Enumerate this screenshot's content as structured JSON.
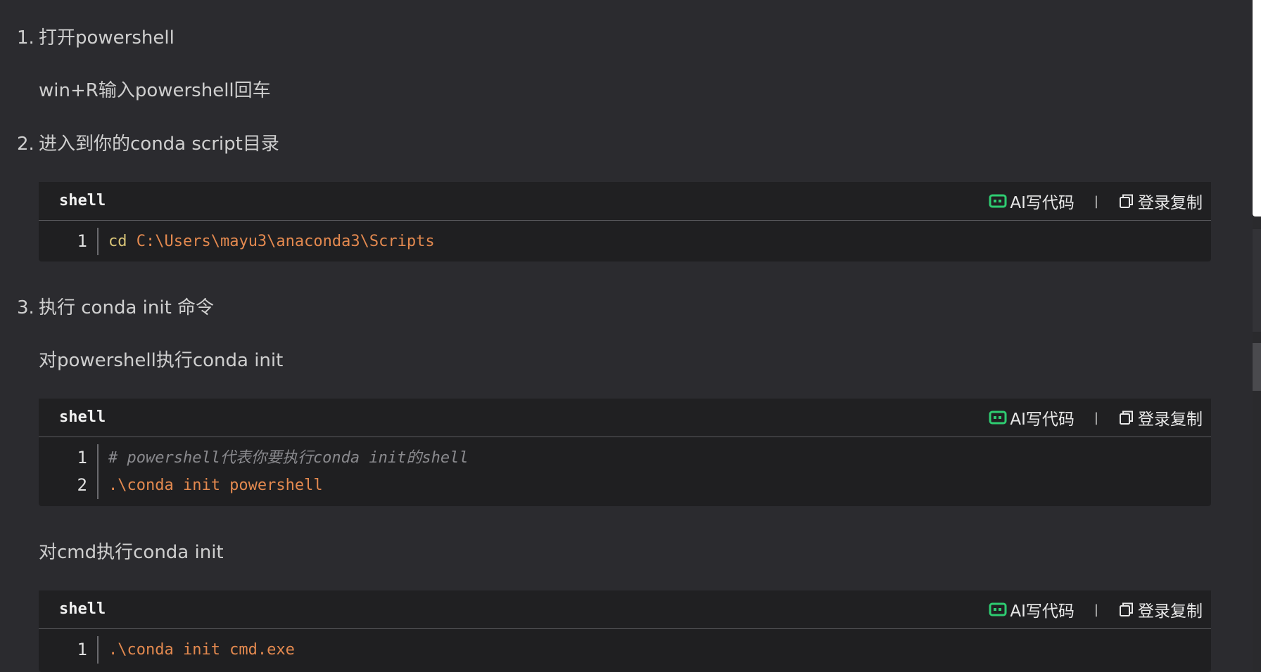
{
  "steps": [
    {
      "num": "1.",
      "title": "打开powershell"
    },
    {
      "num": "2.",
      "title": "进入到你的conda script目录"
    },
    {
      "num": "3.",
      "title": "执行 conda init 命令"
    }
  ],
  "paragraphs": {
    "p1": "win+R输入powershell回车",
    "p2": "对powershell执行conda init",
    "p3": "对cmd执行conda init"
  },
  "code_blocks": [
    {
      "lang": "shell",
      "ai_label": "AI写代码",
      "copy_label": "登录复制",
      "lines": [
        {
          "num": "1",
          "cmd": "cd ",
          "rest": "C:\\Users\\mayu3\\anaconda3\\Scripts"
        }
      ]
    },
    {
      "lang": "shell",
      "ai_label": "AI写代码",
      "copy_label": "登录复制",
      "lines": [
        {
          "num": "1",
          "comment": "# powershell代表你要执行conda init的shell"
        },
        {
          "num": "2",
          "rest": ".\\conda init powershell"
        }
      ]
    },
    {
      "lang": "shell",
      "ai_label": "AI写代码",
      "copy_label": "登录复制",
      "lines": [
        {
          "num": "1",
          "rest": ".\\conda init cmd.exe"
        }
      ]
    }
  ],
  "colors": {
    "background": "#2b2b2f",
    "code_bg": "#1f1f21",
    "ai_icon": "#2ecc71",
    "path": "#e3894f",
    "cmd": "#d8c477",
    "comment": "#8a8a8e"
  },
  "icons": {
    "ai": "ai-chat-icon",
    "copy": "copy-icon"
  }
}
